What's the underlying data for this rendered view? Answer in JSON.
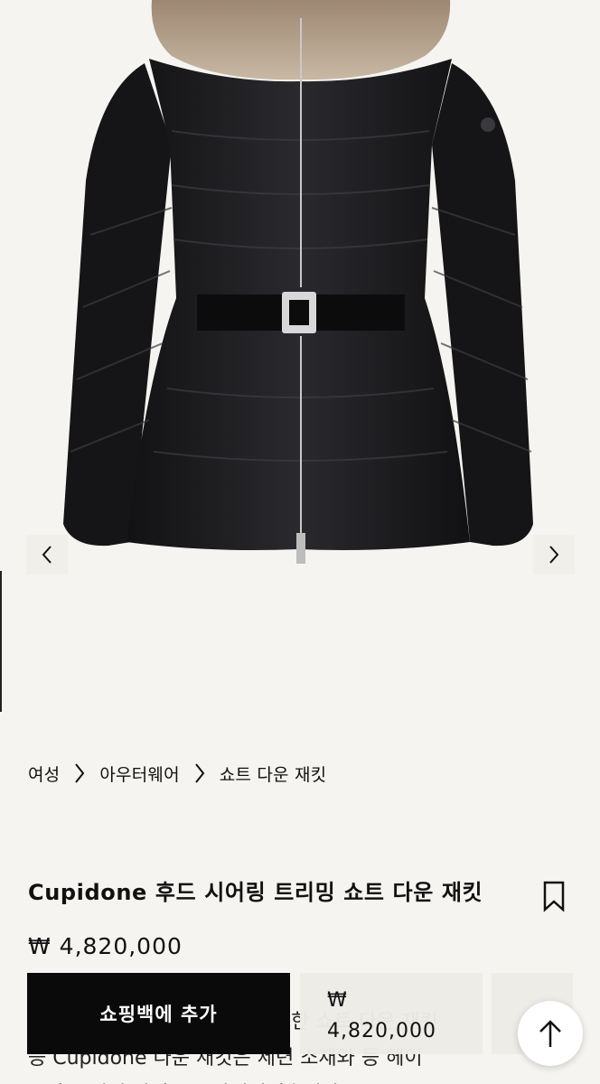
{
  "product_image": {
    "alt_icon": "down-jacket-image"
  },
  "gallery": {
    "prev_icon": "chevron-left-icon",
    "next_icon": "chevron-right-icon"
  },
  "breadcrumb": [
    {
      "label": "여성"
    },
    {
      "label": "아우터웨어"
    },
    {
      "label": "쇼트 다운 재킷"
    }
  ],
  "product": {
    "title": "Cupidone 후드 시어링 트리밍 쇼트 다운 재킷",
    "price": "₩ 4,820,000",
    "description_lines": [
      "숄 디테일 트리밍과 벨트로 완성한 쇼트 다운 재킷",
      "등 Cupidone 다운 재킷은 세련 소재와 등 헤이",
      "스가 트리밍 장식으로 완성되었습니다."
    ]
  },
  "sticky_bar": {
    "add_to_bag_label": "쇼핑백에 추가",
    "price_currency": "₩",
    "price_value": "4,820,000"
  },
  "colors": {
    "accent": "#0a0a0a",
    "background": "#f5f4f0"
  }
}
